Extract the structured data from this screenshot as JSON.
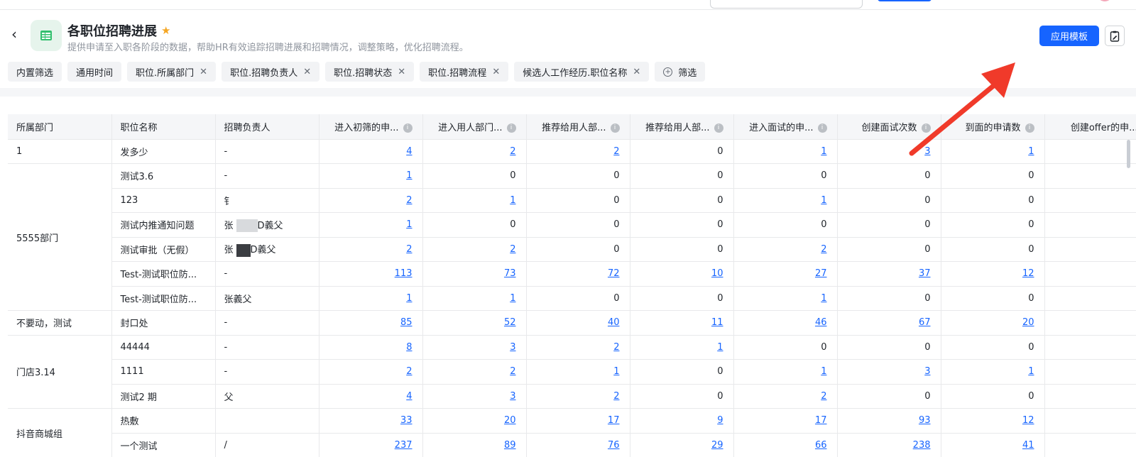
{
  "header": {
    "back_icon": "chevron-left-icon",
    "app_icon": "table-icon",
    "title": "各职位招聘进展",
    "star_icon": "star-icon",
    "description": "提供申请至入职各阶段的数据，帮助HR有效追踪招聘进展和招聘情况，调整策略，优化招聘流程。",
    "apply_button": "应用模板",
    "edit_icon": "clipboard-edit-icon"
  },
  "filters": [
    {
      "label": "内置筛选",
      "removable": false
    },
    {
      "label": "通用时间",
      "removable": false
    },
    {
      "label": "职位.所属部门",
      "removable": true
    },
    {
      "label": "职位.招聘负责人",
      "removable": true
    },
    {
      "label": "职位.招聘状态",
      "removable": true
    },
    {
      "label": "职位.招聘流程",
      "removable": true
    },
    {
      "label": "候选人工作经历.职位名称",
      "removable": true
    }
  ],
  "filter_add": "筛选",
  "table": {
    "columns": [
      "所属部门",
      "职位名称",
      "招聘负责人",
      "进入初筛的申...",
      "进入用人部门...",
      "推荐给用人部...",
      "推荐给用人部...",
      "进入面试的申...",
      "创建面试次数",
      "到面的申请数",
      "创建offer的申..."
    ],
    "rows": [
      {
        "dept": "1",
        "deptSpan": 1,
        "name": "发多少",
        "owner": "-",
        "v": [
          "4",
          "2",
          "2",
          "0",
          "1",
          "3",
          "1"
        ],
        "link": [
          1,
          1,
          1,
          0,
          1,
          1,
          1
        ]
      },
      {
        "dept": "5555部门",
        "deptSpan": 6,
        "name": "测试3.6",
        "owner": "-",
        "v": [
          "1",
          "0",
          "0",
          "0",
          "0",
          "0",
          "0"
        ],
        "link": [
          1,
          0,
          0,
          0,
          0,
          0,
          0
        ]
      },
      {
        "name": "123",
        "owner": "钅",
        "v": [
          "2",
          "1",
          "0",
          "0",
          "1",
          "0",
          "0"
        ],
        "link": [
          1,
          1,
          0,
          0,
          1,
          0,
          0
        ]
      },
      {
        "name": "测试内推通知问题",
        "owner": "张",
        "ownerTail": "D義父",
        "blur": "light",
        "v": [
          "1",
          "0",
          "0",
          "0",
          "0",
          "0",
          "0"
        ],
        "link": [
          1,
          0,
          0,
          0,
          0,
          0,
          0
        ]
      },
      {
        "name": "测试审批（无假）",
        "owner": "张",
        "ownerTail": "D義父",
        "blur": "dark",
        "v": [
          "2",
          "2",
          "0",
          "0",
          "2",
          "0",
          "0"
        ],
        "link": [
          1,
          1,
          0,
          0,
          1,
          0,
          0
        ]
      },
      {
        "name": "Test-测试职位防...",
        "owner": "-",
        "v": [
          "113",
          "73",
          "72",
          "10",
          "27",
          "37",
          "12"
        ],
        "link": [
          1,
          1,
          1,
          1,
          1,
          1,
          1
        ]
      },
      {
        "name": "Test-测试职位防...",
        "owner": "张",
        "ownerTail": "義父",
        "v": [
          "1",
          "1",
          "0",
          "0",
          "1",
          "0",
          "0"
        ],
        "link": [
          1,
          1,
          0,
          0,
          1,
          0,
          0
        ]
      },
      {
        "dept": "不要动，测试",
        "deptSpan": 1,
        "name": "封口处",
        "owner": "-",
        "v": [
          "85",
          "52",
          "40",
          "11",
          "46",
          "67",
          "20"
        ],
        "link": [
          1,
          1,
          1,
          1,
          1,
          1,
          1
        ]
      },
      {
        "dept": "门店3.14",
        "deptSpan": 3,
        "name": "44444",
        "owner": "-",
        "v": [
          "8",
          "3",
          "2",
          "1",
          "0",
          "0",
          "0"
        ],
        "link": [
          1,
          1,
          1,
          1,
          0,
          0,
          0
        ]
      },
      {
        "name": "1111",
        "owner": "-",
        "v": [
          "2",
          "2",
          "1",
          "0",
          "1",
          "3",
          "1"
        ],
        "link": [
          1,
          1,
          1,
          0,
          1,
          1,
          1
        ]
      },
      {
        "name": "测试2 期",
        "owner": "",
        "ownerTail": "父",
        "v": [
          "4",
          "3",
          "2",
          "0",
          "2",
          "0",
          "0"
        ],
        "link": [
          1,
          1,
          1,
          0,
          1,
          0,
          0
        ]
      },
      {
        "dept": "抖音商城组",
        "deptSpan": 2,
        "name": "热敷",
        "owner": "",
        "v": [
          "33",
          "20",
          "17",
          "9",
          "17",
          "93",
          "12"
        ],
        "link": [
          1,
          1,
          1,
          1,
          1,
          1,
          1
        ]
      },
      {
        "name": "一个测试",
        "owner": "/",
        "v": [
          "237",
          "89",
          "76",
          "29",
          "66",
          "238",
          "41"
        ],
        "link": [
          1,
          1,
          1,
          1,
          1,
          1,
          1
        ]
      }
    ]
  },
  "colors": {
    "primary": "#1664ff",
    "annotation_arrow": "#f03a2a",
    "star": "#f5a623"
  }
}
